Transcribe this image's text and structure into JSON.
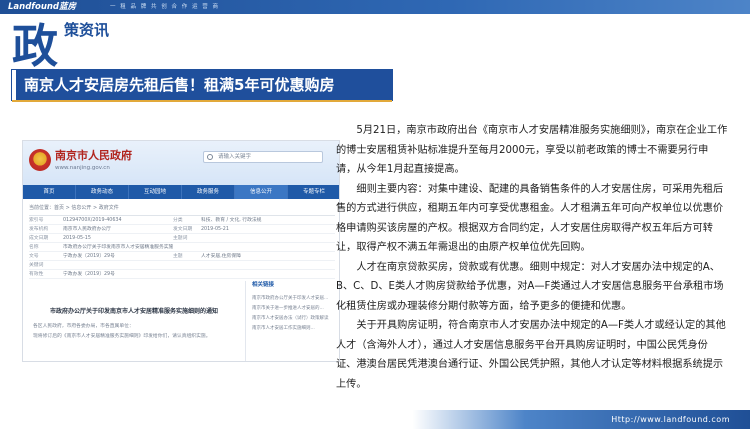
{
  "brand": {
    "logo_text": "Landfound蓝房",
    "tagline": "一 租 品 牌 共 创 合 作 运 营 商"
  },
  "section": {
    "big_char": "政",
    "title": "策资讯"
  },
  "headline": "南京人才安居房先租后售！租满5年可优惠购房",
  "website": {
    "gov_name": "南京市人民政府",
    "url": "www.nanjing.gov.cn",
    "search_placeholder": "请输入关键字",
    "nav": [
      "首页",
      "政务动态",
      "互动园地",
      "政务服务",
      "信息公开",
      "专题专栏"
    ],
    "breadcrumb": "当前位置：首页 > 信息公开 > 政府文件",
    "meta_rows": [
      {
        "k": "索引号",
        "v": "01294700X/2019-40634",
        "k2": "分类",
        "v2": "科技、教育 / 文化, 行政法规"
      },
      {
        "k": "发布机构",
        "v": "南京市人民政府办公厅",
        "k2": "发文日期",
        "v2": "2019-05-21"
      },
      {
        "k": "成文日期",
        "v": "2019-05-15",
        "k2": "主题词",
        "v2": ""
      },
      {
        "k": "名称",
        "v": "市政府办公厅关于印发南京市人才安居精准服务实施细则的通知",
        "k2": "",
        "v2": ""
      },
      {
        "k": "文号",
        "v": "宁政办发〔2019〕29号",
        "k2": "主题",
        "v2": "人才安居,住房保障"
      },
      {
        "k": "关键词",
        "v": "",
        "k2": "",
        "v2": ""
      },
      {
        "k": "有效性",
        "v": "宁政办发〔2019〕29号",
        "k2": "",
        "v2": ""
      }
    ],
    "doc_title": "市政府办公厅关于印发南京市人才安居精准服务实施细则的通知",
    "doc_lines": [
      "各区人民政府，市府各委办局，市各直属单位：",
      "现将修订后的《南京市人才安居精准服务实施细则》印发给你们，请认真组织实施。"
    ],
    "related_title": "相关链接",
    "related_items": [
      "南京市政府办公厅关于印发人才安居...",
      "南京市关于进一步推进人才安居的...",
      "南京市人才安居办法（试行）政策解读",
      "南京市人才安居工作实施细则..."
    ]
  },
  "article": {
    "paragraphs": [
      "5月21日，南京市政府出台《南京市人才安居精准服务实施细则》，南京在企业工作的博士安居租赁补贴标准提升至每月2000元，享受以前老政策的博士不需要另行申请，从今年1月起直接提高。",
      "细则主要内容：对集中建设、配建的具备销售条件的人才安居住房，可采用先租后售的方式进行供应，租期五年内可享受优惠租金。人才租满五年可向产权单位以优惠价格申请购买该房屋的产权。根据双方合同约定，人才安居住房取得产权五年后方可转让，取得产权不满五年需退出的由原产权单位优先回购。",
      "人才在南京贷款买房，贷款或有优惠。细则中规定：对人才安居办法中规定的A、B、C、D、E类人才购房贷款给予优惠，对A—F类通过人才安居信息服务平台承租市场化租赁住房或办理装修分期付款等方面，给予更多的便捷和优惠。",
      "关于开具购房证明，符合南京市人才安居办法中规定的A—F类人才或经认定的其他人才（含海外人才），通过人才安居信息服务平台开具购房证明时，中国公民凭身份证、港澳台居民凭港澳台通行证、外国公民凭护照，其他人才认定等材料根据系统提示上传。"
    ]
  },
  "footer": {
    "url": "Http://www.landfound.com"
  },
  "colors": {
    "brand_blue": "#1f4f9c",
    "accent_gold": "#e2a93a",
    "gov_red": "#b1241e"
  }
}
